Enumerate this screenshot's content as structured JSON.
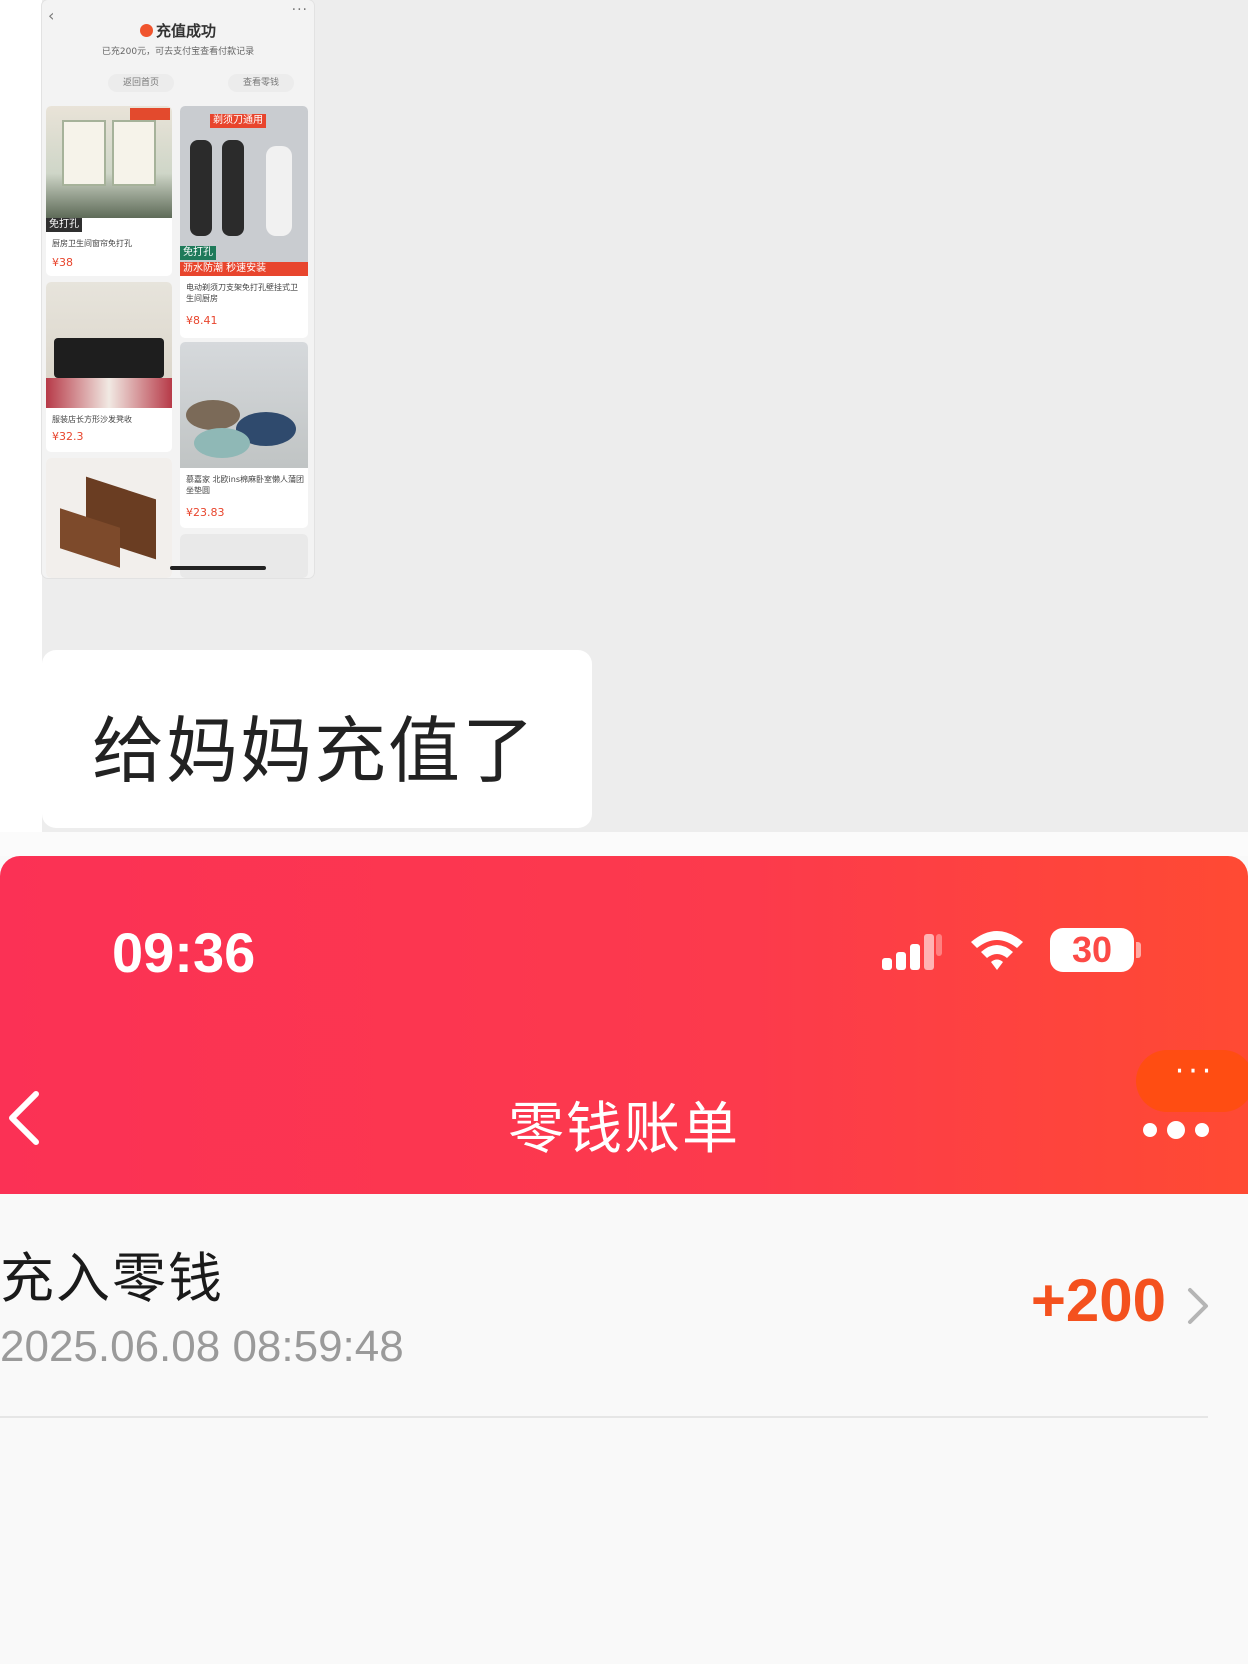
{
  "chat": {
    "thumbnail": {
      "title": "充值成功",
      "subtitle": "已充200元，可去支付宝查看付款记录",
      "buttons": [
        "返回首页",
        "查看零钱"
      ],
      "products": [
        {
          "tag": "免打孔",
          "caption": "厨房卫生间窗帘免打孔",
          "price": "¥38"
        },
        {
          "tag": "剃须刀通用",
          "caption": "电动剃须刀支架免打孔壁挂式卫生间厨房",
          "price": "¥8.41",
          "banner": "沥水防潮 秒速安装"
        },
        {
          "tag": "",
          "caption": "服装店长方形沙发凳收",
          "price": "¥32.3"
        },
        {
          "tag": "",
          "caption": "慕嘉家 北欧ins棉麻卧室懒人蒲团坐垫圆",
          "price": "¥23.83"
        },
        {
          "tag": "",
          "caption": "",
          "price": ""
        }
      ]
    },
    "message": "给妈妈充值了"
  },
  "status_bar": {
    "time": "09:36",
    "battery": "30",
    "battery_level_percent": 30
  },
  "nav": {
    "title": "零钱账单",
    "badge": "···"
  },
  "transactions": [
    {
      "title": "充入零钱",
      "time": "2025.06.08 08:59:48",
      "amount": "+200"
    }
  ],
  "colors": {
    "header_gradient_start": "#fb3155",
    "header_gradient_end": "#ff4a33",
    "amount": "#f4511e",
    "badge": "#ff4d12"
  }
}
